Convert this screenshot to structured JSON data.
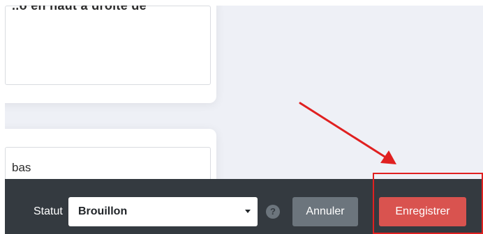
{
  "top_field": {
    "value": "..o en haut à droite de"
  },
  "bottom_field": {
    "value": "bas"
  },
  "footer": {
    "status_label": "Statut",
    "status_value": "Brouillon",
    "help_icon": "question-circle",
    "cancel_label": "Annuler",
    "save_label": "Enregistrer"
  },
  "annotation": {
    "arrow_color": "#e02020",
    "box_color": "#e02020"
  },
  "colors": {
    "footer_bg": "#343a40",
    "save_bg": "#d9534f",
    "cancel_bg": "#6c757d",
    "canvas_bg": "#eef0f6"
  }
}
